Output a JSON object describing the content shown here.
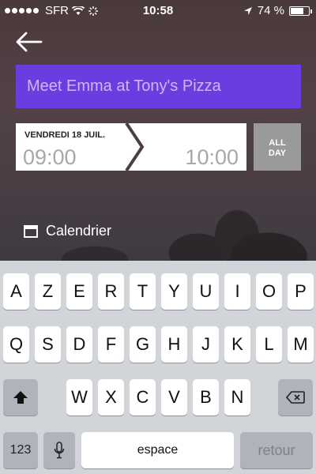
{
  "status_bar": {
    "carrier": "SFR",
    "time": "10:58",
    "battery_percent": "74 %",
    "battery_level": 0.74,
    "signal_bars": 5
  },
  "event": {
    "title": "Meet Emma at Tony's Pizza",
    "date_label": "VENDREDI 18 JUIL.",
    "start_time": "09:00",
    "end_time": "10:00",
    "all_day_label": "ALL\nDAY",
    "calendar_label": "Calendrier"
  },
  "keyboard": {
    "row1": [
      "A",
      "Z",
      "E",
      "R",
      "T",
      "Y",
      "U",
      "I",
      "O",
      "P"
    ],
    "row2": [
      "Q",
      "S",
      "D",
      "F",
      "G",
      "H",
      "J",
      "K",
      "L",
      "M"
    ],
    "row3": [
      "W",
      "X",
      "C",
      "V",
      "B",
      "N"
    ],
    "numbers_label": "123",
    "space_label": "espace",
    "return_label": "retour"
  },
  "colors": {
    "accent": "#6a3de0",
    "all_day_bg": "#9a9a9a"
  },
  "icons": [
    "back-arrow-icon",
    "wifi-icon",
    "activity-spinner-icon",
    "location-arrow-icon",
    "battery-icon",
    "calendar-icon",
    "shift-icon",
    "microphone-icon",
    "delete-icon"
  ]
}
